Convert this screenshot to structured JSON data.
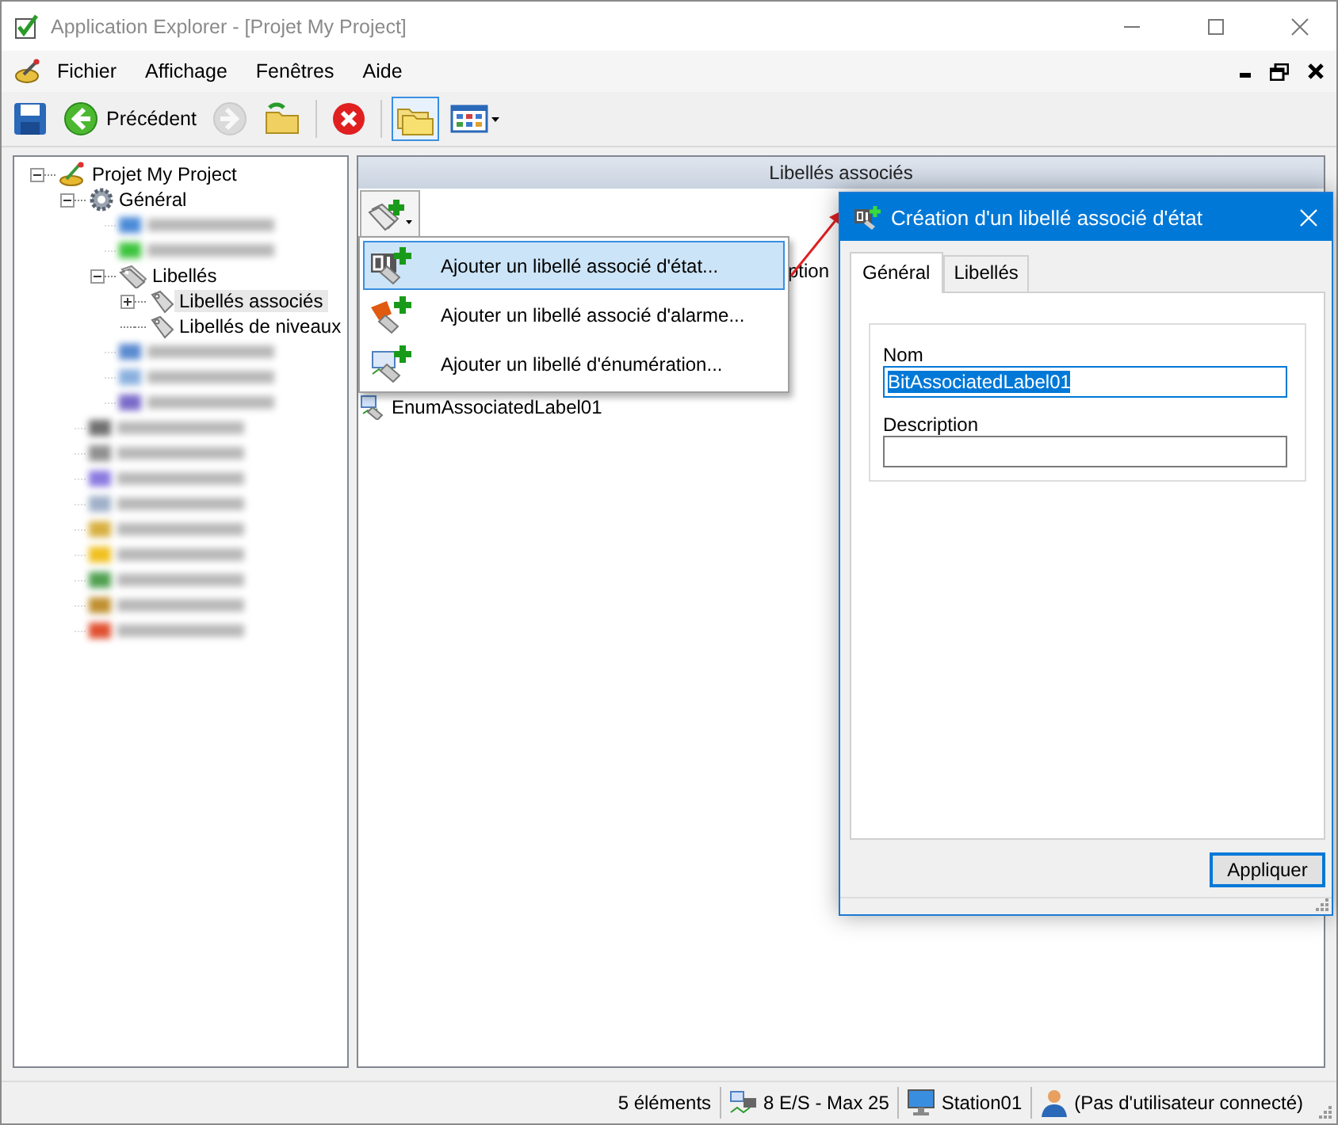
{
  "window": {
    "title": "Application Explorer - [Projet My Project]"
  },
  "menu": [
    "Fichier",
    "Affichage",
    "Fenêtres",
    "Aide"
  ],
  "toolbar": {
    "back_label": "Précédent",
    "buttons": [
      {
        "kind": "save",
        "disabled": false
      },
      {
        "kind": "back",
        "disabled": false
      },
      {
        "kind": "forward",
        "disabled": true
      },
      {
        "kind": "folder-refresh",
        "disabled": false
      },
      {
        "kind": "stop",
        "disabled": false
      },
      {
        "kind": "folders",
        "selected": true
      },
      {
        "kind": "view",
        "selected": false
      }
    ]
  },
  "tree": [
    {
      "kind": "project",
      "label": "Projet My Project",
      "selected": false,
      "expanded": true,
      "children": [
        {
          "kind": "settings",
          "label": "Général",
          "selected": false,
          "expanded": true,
          "children": [
            {
              "kind": "blurred"
            },
            {
              "kind": "blurred"
            },
            {
              "kind": "labels",
              "label": "Libellés",
              "selected": false,
              "expanded": true,
              "children": [
                {
                  "kind": "label",
                  "label": "Libellés associés",
                  "selected": true,
                  "expanded": false
                },
                {
                  "kind": "label",
                  "label": "Libellés de niveaux",
                  "selected": false
                }
              ]
            },
            {
              "kind": "blurred"
            },
            {
              "kind": "blurred"
            },
            {
              "kind": "blurred"
            }
          ]
        },
        {
          "kind": "blurred"
        },
        {
          "kind": "blurred"
        },
        {
          "kind": "blurred"
        },
        {
          "kind": "blurred"
        },
        {
          "kind": "blurred"
        },
        {
          "kind": "blurred"
        },
        {
          "kind": "blurred"
        },
        {
          "kind": "blurred"
        },
        {
          "kind": "blurred"
        }
      ]
    }
  ],
  "content": {
    "header": "Libellés associés",
    "column_header": "ption",
    "items": [
      {
        "label": "EnumAssociatedLabel01"
      }
    ]
  },
  "popup_menu": [
    {
      "kind": "state",
      "label": "Ajouter un libellé associé d'état...",
      "selected": true
    },
    {
      "kind": "alarm",
      "label": "Ajouter un libellé associé d'alarme...",
      "selected": false
    },
    {
      "kind": "enum",
      "label": "Ajouter un libellé d'énumération...",
      "selected": false
    }
  ],
  "dialog": {
    "title": "Création d'un libellé associé d'état",
    "tabs": [
      {
        "label": "Général",
        "selected": true
      },
      {
        "label": "Libellés",
        "selected": false
      }
    ],
    "fields": [
      {
        "label": "Nom",
        "value": "BitAssociatedLabel01",
        "highlighted": true
      },
      {
        "label": "Description",
        "highlighted": false
      }
    ],
    "button": "Appliquer"
  },
  "status_bar": [
    {
      "kind": "text",
      "text": "5 éléments"
    },
    {
      "kind": "io",
      "text": "8 E/S - Max 25"
    },
    {
      "kind": "station",
      "text": "Station01"
    },
    {
      "kind": "user",
      "text": "(Pas d'utilisateur connecté)"
    }
  ]
}
